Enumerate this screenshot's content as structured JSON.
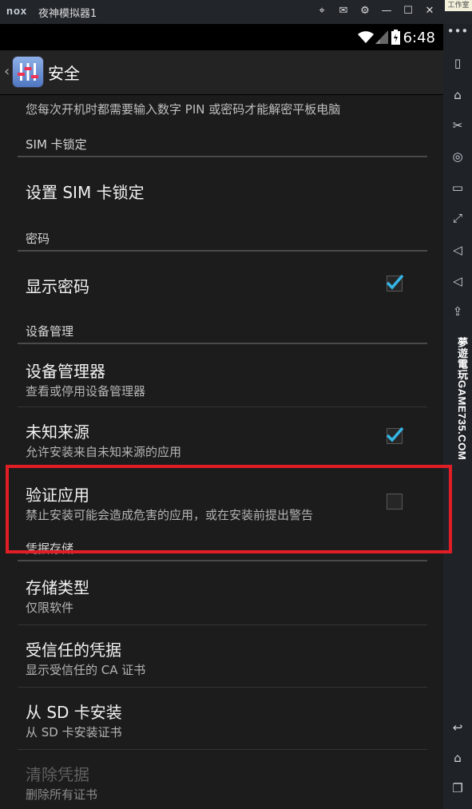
{
  "emulator": {
    "logo": "nox",
    "title": "夜神模拟器1",
    "buttons": [
      "⌖",
      "✉",
      "⚙",
      "—",
      "☐",
      "✕"
    ],
    "corner_label": "工作室",
    "watermark": "夢遊電玩GAME735.COM",
    "toolbar_icons": [
      "more-icon",
      "rotate-icon",
      "robot-icon",
      "scissors-icon",
      "location-icon",
      "keyboard-icon",
      "fullscreen-icon",
      "volume-up-icon",
      "volume-down-icon",
      "apk-icon",
      "shake-icon",
      "screenshot-icon",
      "multi-icon",
      "copy-icon",
      "back-icon",
      "home-icon",
      "recents-icon"
    ]
  },
  "status_bar": {
    "time": "6:48"
  },
  "action_bar": {
    "back": "‹",
    "title": "安全"
  },
  "content": {
    "cut_summary": "您每次开机时都需要输入数字 PIN 或密码才能解密平板电脑",
    "categories": [
      {
        "label": "SIM 卡锁定"
      },
      {
        "label": "密码"
      },
      {
        "label": "设备管理"
      },
      {
        "label": "凭据存储"
      }
    ],
    "prefs": [
      {
        "title": "设置 SIM 卡锁定",
        "summary": ""
      },
      {
        "title": "显示密码",
        "summary": "",
        "checked": true
      },
      {
        "title": "设备管理器",
        "summary": "查看或停用设备管理器"
      },
      {
        "title": "未知来源",
        "summary": "允许安装来自未知来源的应用",
        "checked": true
      },
      {
        "title": "验证应用",
        "summary": "禁止安装可能会造成危害的应用，或在安装前提出警告",
        "checked": false
      },
      {
        "title": "存储类型",
        "summary": "仅限软件"
      },
      {
        "title": "受信任的凭据",
        "summary": "显示受信任的 CA 证书"
      },
      {
        "title": "从 SD 卡安装",
        "summary": "从 SD 卡安装证书"
      },
      {
        "title": "清除凭据",
        "summary": "删除所有证书",
        "disabled": true
      }
    ]
  },
  "colors": {
    "accent": "#33b5e5",
    "highlight": "#e11e25"
  }
}
